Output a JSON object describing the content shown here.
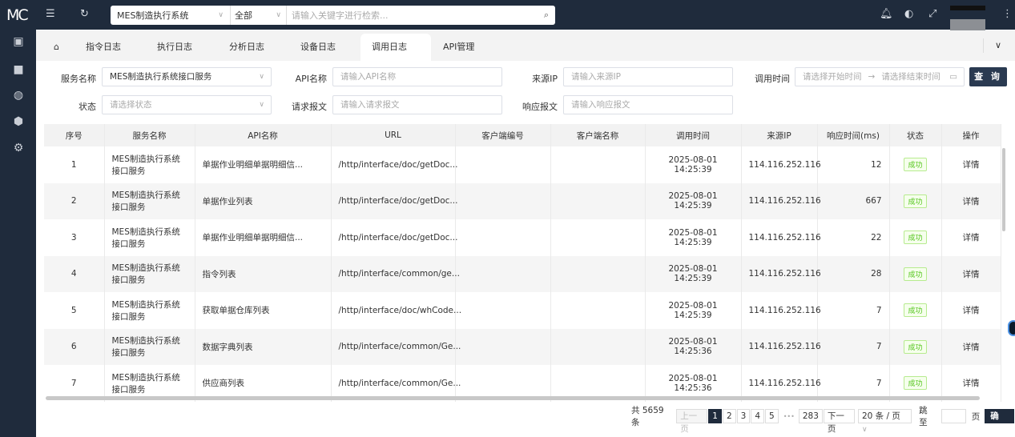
{
  "app": {
    "logo": "MC"
  },
  "topbar": {
    "system_select": "MES制造执行系统",
    "scope_select": "全部",
    "search_placeholder": "请输入关键字进行检索..."
  },
  "tabs": [
    {
      "label": "指令日志"
    },
    {
      "label": "执行日志"
    },
    {
      "label": "分析日志"
    },
    {
      "label": "设备日志"
    },
    {
      "label": "调用日志",
      "active": true
    },
    {
      "label": "API管理"
    }
  ],
  "filters": {
    "service_name": {
      "label": "服务名称",
      "value": "MES制造执行系统接口服务"
    },
    "api_name": {
      "label": "API名称",
      "placeholder": "请输入API名称"
    },
    "source_ip": {
      "label": "来源IP",
      "placeholder": "请输入来源IP"
    },
    "call_time": {
      "label": "调用时间",
      "start_placeholder": "请选择开始时间",
      "end_placeholder": "请选择结束时间",
      "separator": "→"
    },
    "status": {
      "label": "状态",
      "placeholder": "请选择状态"
    },
    "request_body": {
      "label": "请求报文",
      "placeholder": "请输入请求报文"
    },
    "response_body": {
      "label": "响应报文",
      "placeholder": "请输入响应报文"
    },
    "query_button": "查 询"
  },
  "table": {
    "columns": [
      "序号",
      "服务名称",
      "API名称",
      "URL",
      "客户端编号",
      "客户端名称",
      "调用时间",
      "来源IP",
      "响应时间(ms)",
      "状态",
      "操作"
    ],
    "rows": [
      {
        "no": "1",
        "service": "MES制造执行系统接口服务",
        "api": "单据作业明细单据明细信...",
        "url": "/http/interface/doc/getDoc...",
        "client_no": "",
        "client_name": "",
        "time": "2025-08-01 14:25:39",
        "ip": "114.116.252.116",
        "ms": "12",
        "status": "成功",
        "action": "详情"
      },
      {
        "no": "2",
        "service": "MES制造执行系统接口服务",
        "api": "单据作业列表",
        "url": "/http/interface/doc/getDoc...",
        "client_no": "",
        "client_name": "",
        "time": "2025-08-01 14:25:39",
        "ip": "114.116.252.116",
        "ms": "667",
        "status": "成功",
        "action": "详情"
      },
      {
        "no": "3",
        "service": "MES制造执行系统接口服务",
        "api": "单据作业明细单据明细信...",
        "url": "/http/interface/doc/getDoc...",
        "client_no": "",
        "client_name": "",
        "time": "2025-08-01 14:25:39",
        "ip": "114.116.252.116",
        "ms": "22",
        "status": "成功",
        "action": "详情"
      },
      {
        "no": "4",
        "service": "MES制造执行系统接口服务",
        "api": "指令列表",
        "url": "/http/interface/common/ge...",
        "client_no": "",
        "client_name": "",
        "time": "2025-08-01 14:25:39",
        "ip": "114.116.252.116",
        "ms": "28",
        "status": "成功",
        "action": "详情"
      },
      {
        "no": "5",
        "service": "MES制造执行系统接口服务",
        "api": "获取单据仓库列表",
        "url": "/http/interface/doc/whCode...",
        "client_no": "",
        "client_name": "",
        "time": "2025-08-01 14:25:39",
        "ip": "114.116.252.116",
        "ms": "7",
        "status": "成功",
        "action": "详情"
      },
      {
        "no": "6",
        "service": "MES制造执行系统接口服务",
        "api": "数据字典列表",
        "url": "/http/interface/common/Ge...",
        "client_no": "",
        "client_name": "",
        "time": "2025-08-01 14:25:36",
        "ip": "114.116.252.116",
        "ms": "7",
        "status": "成功",
        "action": "详情"
      },
      {
        "no": "7",
        "service": "MES制造执行系统接口服务",
        "api": "供应商列表",
        "url": "/http/interface/common/Ge...",
        "client_no": "",
        "client_name": "",
        "time": "2025-08-01 14:25:36",
        "ip": "114.116.252.116",
        "ms": "7",
        "status": "成功",
        "action": "详情"
      }
    ]
  },
  "pagination": {
    "total": "共 5659 条",
    "prev": "上一页",
    "pages": [
      "1",
      "2",
      "3",
      "4",
      "5"
    ],
    "ellipsis": "•••",
    "last": "283",
    "next": "下一页",
    "page_size": "20 条 / 页",
    "jump_label": "跳至",
    "jump_value": "",
    "page_suffix": "页",
    "confirm": "确 定"
  }
}
